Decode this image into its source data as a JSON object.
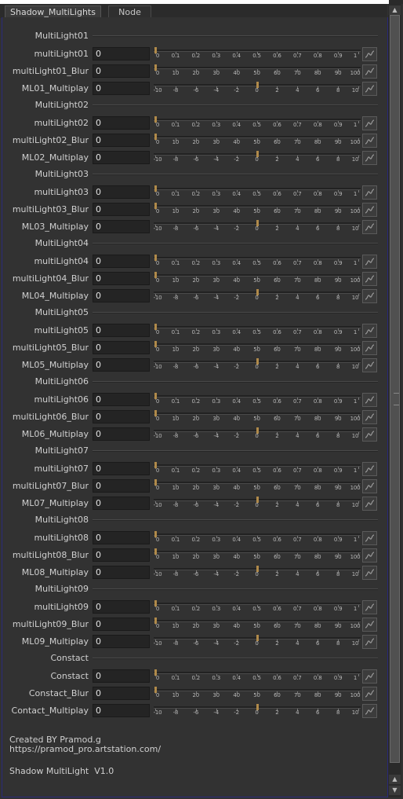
{
  "tabs": [
    {
      "label": "Shadow_MultiLights"
    },
    {
      "label": "Node"
    }
  ],
  "groups": [
    {
      "title": "MultiLight01",
      "rows": [
        {
          "label": "multiLight01",
          "value": "0",
          "scale": "a",
          "level": 0
        },
        {
          "label": "multiLight01_Blur",
          "value": "0",
          "scale": "b",
          "level": 0
        },
        {
          "label": "ML01_Multiplay",
          "value": "0",
          "scale": "c",
          "level": 0.5
        }
      ]
    },
    {
      "title": "MultiLight02",
      "rows": [
        {
          "label": "multiLight02",
          "value": "0",
          "scale": "a",
          "level": 0
        },
        {
          "label": "multiLight02_Blur",
          "value": "0",
          "scale": "b",
          "level": 0
        },
        {
          "label": "ML02_Multiplay",
          "value": "0",
          "scale": "c",
          "level": 0.5
        }
      ]
    },
    {
      "title": "MultiLight03",
      "rows": [
        {
          "label": "multiLight03",
          "value": "0",
          "scale": "a",
          "level": 0
        },
        {
          "label": "multiLight03_Blur",
          "value": "0",
          "scale": "b",
          "level": 0
        },
        {
          "label": "ML03_Multiplay",
          "value": "0",
          "scale": "c",
          "level": 0.5
        }
      ]
    },
    {
      "title": "MultiLight04",
      "rows": [
        {
          "label": "multiLight04",
          "value": "0",
          "scale": "a",
          "level": 0
        },
        {
          "label": "multiLight04_Blur",
          "value": "0",
          "scale": "b",
          "level": 0
        },
        {
          "label": "ML04_Multiplay",
          "value": "0",
          "scale": "c",
          "level": 0.5
        }
      ]
    },
    {
      "title": "MultiLight05",
      "rows": [
        {
          "label": "multiLight05",
          "value": "0",
          "scale": "a",
          "level": 0
        },
        {
          "label": "multiLight05_Blur",
          "value": "0",
          "scale": "b",
          "level": 0
        },
        {
          "label": "ML05_Multiplay",
          "value": "0",
          "scale": "c",
          "level": 0.5
        }
      ]
    },
    {
      "title": "MultiLight06",
      "rows": [
        {
          "label": "multiLight06",
          "value": "0",
          "scale": "a",
          "level": 0
        },
        {
          "label": "multiLight06_Blur",
          "value": "0",
          "scale": "b",
          "level": 0
        },
        {
          "label": "ML06_Multiplay",
          "value": "0",
          "scale": "c",
          "level": 0.5
        }
      ]
    },
    {
      "title": "MultiLight07",
      "rows": [
        {
          "label": "multiLight07",
          "value": "0",
          "scale": "a",
          "level": 0
        },
        {
          "label": "multiLight07_Blur",
          "value": "0",
          "scale": "b",
          "level": 0
        },
        {
          "label": "ML07_Multiplay",
          "value": "0",
          "scale": "c",
          "level": 0.5
        }
      ]
    },
    {
      "title": "MultiLight08",
      "rows": [
        {
          "label": "multiLight08",
          "value": "0",
          "scale": "a",
          "level": 0
        },
        {
          "label": "multiLight08_Blur",
          "value": "0",
          "scale": "b",
          "level": 0
        },
        {
          "label": "ML08_Multiplay",
          "value": "0",
          "scale": "c",
          "level": 0.5
        }
      ]
    },
    {
      "title": "MultiLight09",
      "rows": [
        {
          "label": "multiLight09",
          "value": "0",
          "scale": "a",
          "level": 0
        },
        {
          "label": "multiLight09_Blur",
          "value": "0",
          "scale": "b",
          "level": 0
        },
        {
          "label": "ML09_Multiplay",
          "value": "0",
          "scale": "c",
          "level": 0.5
        }
      ]
    },
    {
      "title": "Constact",
      "rows": [
        {
          "label": "Constact",
          "value": "0",
          "scale": "a",
          "level": 0
        },
        {
          "label": "Constact_Blur",
          "value": "0",
          "scale": "b",
          "level": 0
        },
        {
          "label": "Contact_Multiplay",
          "value": "0",
          "scale": "c",
          "level": 0.5
        }
      ]
    }
  ],
  "scales": {
    "a": [
      "0",
      "0.1",
      "0.2",
      "0.3",
      "0.4",
      "0.5",
      "0.6",
      "0.7",
      "0.8",
      "0.9",
      "1"
    ],
    "b": [
      "0",
      "10",
      "20",
      "30",
      "40",
      "50",
      "60",
      "70",
      "80",
      "90",
      "100"
    ],
    "c": [
      "-10",
      "-8",
      "-6",
      "-4",
      "-2",
      "0",
      "2",
      "4",
      "6",
      "8",
      "10"
    ]
  },
  "footer": {
    "credit": "Created BY Pramod.g",
    "url": "https://pramod_pro.artstation.com/",
    "version": "Shadow MultiLight  V1.0"
  },
  "colors": {
    "background": "#323232",
    "field": "#242424",
    "handle": "#b08a4a",
    "panel_border": "#2a2a7a"
  },
  "icons": {
    "anim_button": "curve-icon",
    "scroll_up": "arrow-up-icon",
    "scroll_down": "arrow-down-icon"
  }
}
